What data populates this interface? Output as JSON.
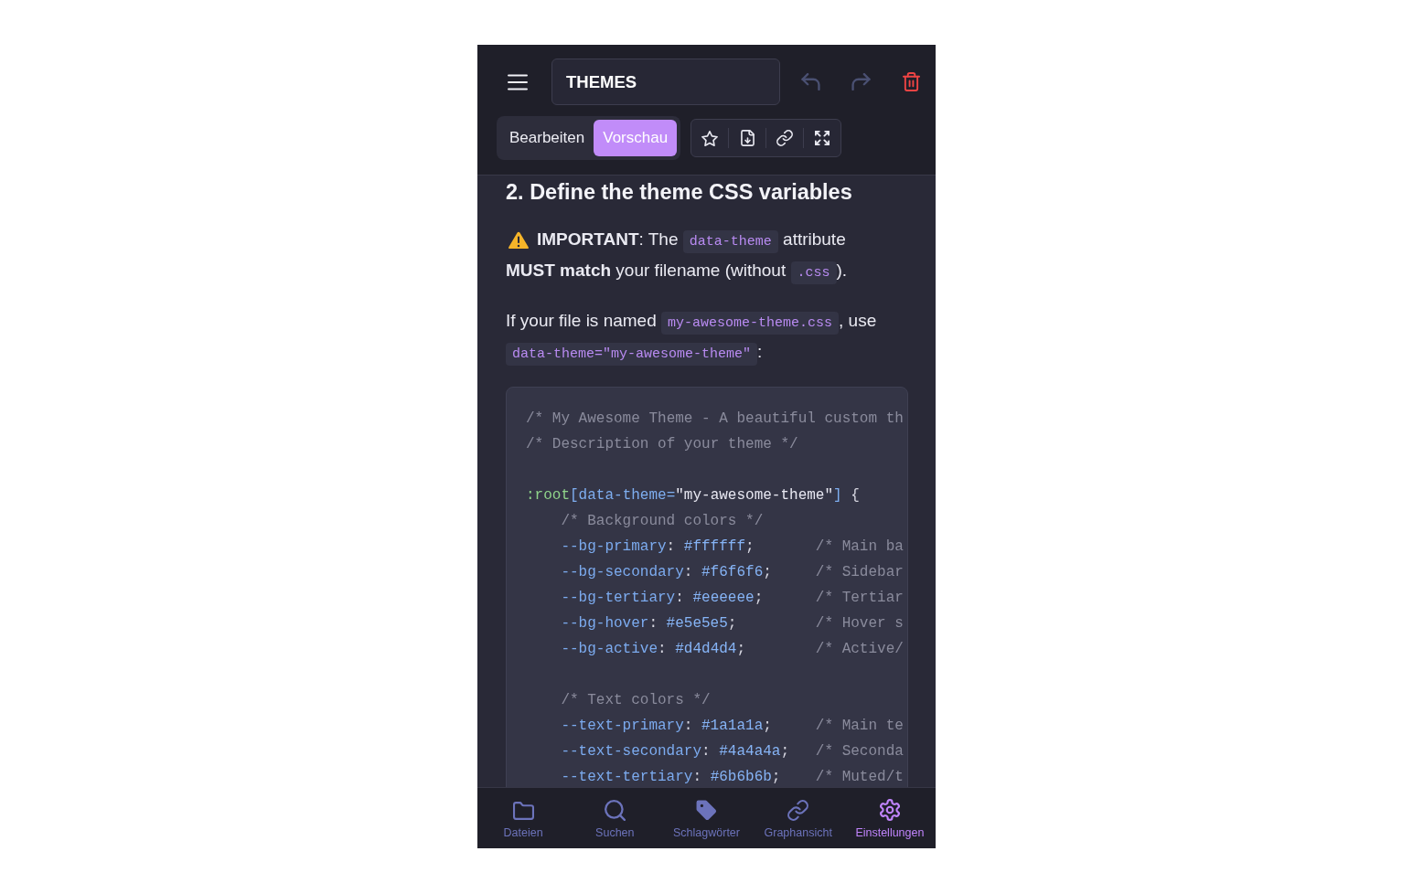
{
  "header": {
    "title_field": {
      "value": "THEMES"
    },
    "history_buttons": [
      {
        "kind": "undo",
        "disabled": true
      },
      {
        "kind": "redo",
        "disabled": true
      }
    ]
  },
  "mode_tabs": [
    {
      "label": "Bearbeiten",
      "selected": false
    },
    {
      "label": "Vorschau",
      "selected": true
    }
  ],
  "content": {
    "heading": "2. Define the theme CSS variables",
    "paragraphs": [
      {
        "kind": "warning",
        "segments": [
          {
            "kind": "text",
            "text": "**IMPORTANT**: The "
          },
          {
            "kind": "code",
            "text": "data-theme"
          },
          {
            "kind": "text",
            "text": " attribute **MUST match** your filename (without "
          },
          {
            "kind": "code",
            "text": ".css"
          },
          {
            "kind": "text",
            "text": ")."
          }
        ]
      },
      {
        "kind": "plain",
        "segments": [
          {
            "kind": "text",
            "text": "If your file is named "
          },
          {
            "kind": "code",
            "text": "my-awesome-theme.css"
          },
          {
            "kind": "text",
            "text": ", use "
          },
          {
            "kind": "code",
            "text": "data-theme=\"my-awesome-theme\""
          },
          {
            "kind": "text",
            "text": ":"
          }
        ]
      }
    ],
    "code_block": {
      "comments": [
        "/* My Awesome Theme - A beautiful custom th",
        "/* Description of your theme */"
      ],
      "selector": [
        {
          "kind": "selector",
          "text": ":root"
        },
        {
          "kind": "attribute",
          "text": "[data-theme="
        },
        {
          "kind": "string",
          "text": "\"my-awesome-theme\""
        },
        {
          "kind": "attribute",
          "text": "]"
        },
        {
          "kind": "punctuation",
          "text": " {"
        }
      ],
      "groups": [
        {
          "comment": "/* Background colors */",
          "declarations": [
            {
              "tokens": [
                {
                  "kind": "property",
                  "text": "--bg-primary"
                },
                {
                  "kind": "punctuation",
                  "text": ": "
                },
                {
                  "kind": "value",
                  "text": "#ffffff"
                },
                {
                  "kind": "punctuation",
                  "text": ";"
                }
              ],
              "comment": "/* Main ba"
            },
            {
              "tokens": [
                {
                  "kind": "property",
                  "text": "--bg-secondary"
                },
                {
                  "kind": "punctuation",
                  "text": ": "
                },
                {
                  "kind": "value",
                  "text": "#f6f6f6"
                },
                {
                  "kind": "punctuation",
                  "text": ";"
                }
              ],
              "comment": "/* Sidebar"
            },
            {
              "tokens": [
                {
                  "kind": "property",
                  "text": "--bg-tertiary"
                },
                {
                  "kind": "punctuation",
                  "text": ": "
                },
                {
                  "kind": "value",
                  "text": "#eeeeee"
                },
                {
                  "kind": "punctuation",
                  "text": ";"
                }
              ],
              "comment": "/* Tertiar"
            },
            {
              "tokens": [
                {
                  "kind": "property",
                  "text": "--bg-hover"
                },
                {
                  "kind": "punctuation",
                  "text": ": "
                },
                {
                  "kind": "value",
                  "text": "#e5e5e5"
                },
                {
                  "kind": "punctuation",
                  "text": ";"
                }
              ],
              "comment": "/* Hover s"
            },
            {
              "tokens": [
                {
                  "kind": "property",
                  "text": "--bg-active"
                },
                {
                  "kind": "punctuation",
                  "text": ": "
                },
                {
                  "kind": "value",
                  "text": "#d4d4d4"
                },
                {
                  "kind": "punctuation",
                  "text": ";"
                }
              ],
              "comment": "/* Active/"
            }
          ]
        },
        {
          "comment": "/* Text colors */",
          "declarations": [
            {
              "tokens": [
                {
                  "kind": "property",
                  "text": "--text-primary"
                },
                {
                  "kind": "punctuation",
                  "text": ": "
                },
                {
                  "kind": "value",
                  "text": "#1a1a1a"
                },
                {
                  "kind": "punctuation",
                  "text": ";"
                }
              ],
              "comment": "/* Main te"
            },
            {
              "tokens": [
                {
                  "kind": "property",
                  "text": "--text-secondary"
                },
                {
                  "kind": "punctuation",
                  "text": ": "
                },
                {
                  "kind": "value",
                  "text": "#4a4a4a"
                },
                {
                  "kind": "punctuation",
                  "text": ";"
                }
              ],
              "comment": "/* Seconda"
            },
            {
              "tokens": [
                {
                  "kind": "property",
                  "text": "--text-tertiary"
                },
                {
                  "kind": "punctuation",
                  "text": ": "
                },
                {
                  "kind": "value",
                  "text": "#6b6b6b"
                },
                {
                  "kind": "punctuation",
                  "text": ";"
                }
              ],
              "comment": "/* Muted/t"
            }
          ]
        }
      ]
    }
  },
  "bottom_nav": [
    {
      "kind": "files",
      "label": "Dateien",
      "selected": false
    },
    {
      "kind": "search",
      "label": "Suchen",
      "selected": false
    },
    {
      "kind": "tags",
      "label": "Schlagwörter",
      "selected": false
    },
    {
      "kind": "graph",
      "label": "Graphansicht",
      "selected": false
    },
    {
      "kind": "settings",
      "label": "Einstellungen",
      "selected": true
    }
  ]
}
